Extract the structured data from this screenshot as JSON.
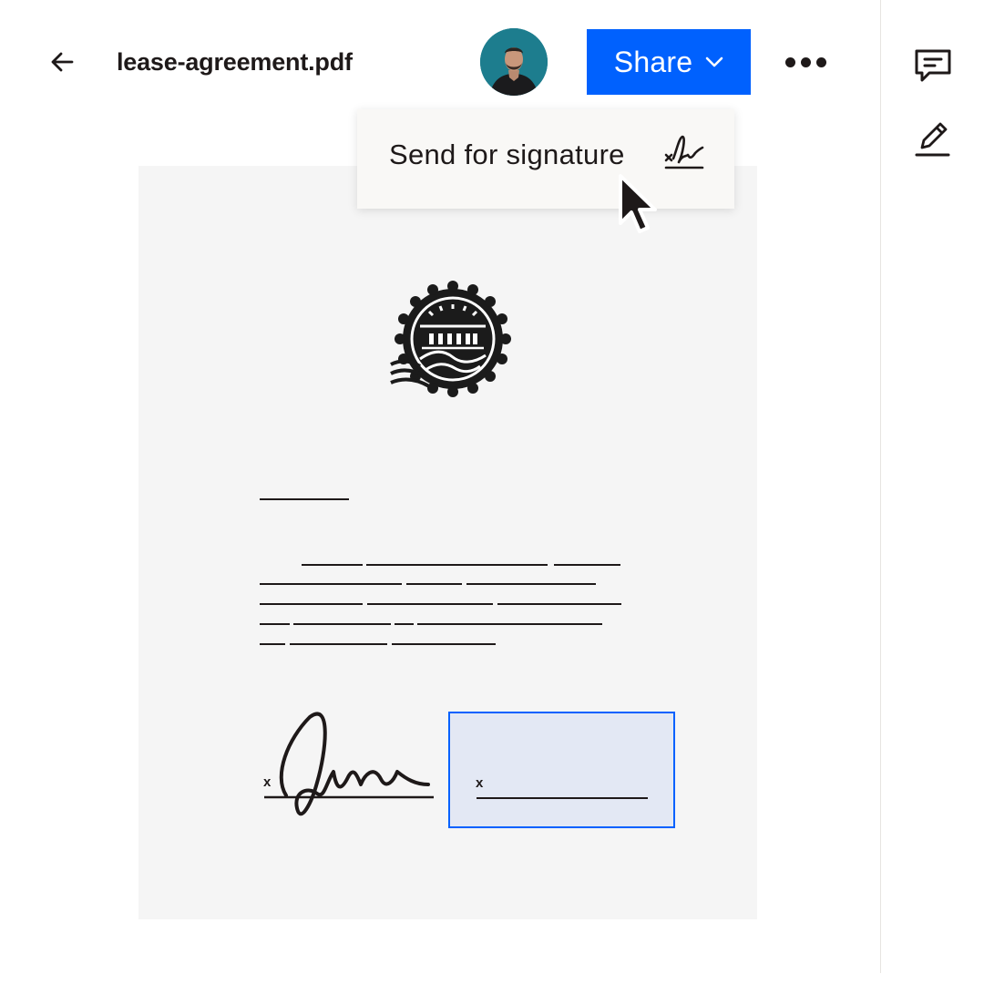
{
  "header": {
    "file_title": "lease-agreement.pdf",
    "share_label": "Share"
  },
  "share_menu": {
    "items": [
      {
        "label": "Send for signature",
        "icon": "signature-icon"
      }
    ]
  },
  "document": {
    "signature_marks": [
      "x",
      "x"
    ]
  },
  "icons": {
    "back": "arrow-left-icon",
    "more": "ellipsis-icon",
    "comment": "comment-icon",
    "edit": "pencil-icon",
    "cursor": "mouse-pointer-icon"
  },
  "colors": {
    "accent": "#0061fe",
    "signature_box": "#e3e8f4",
    "page": "#f5f5f5",
    "menu": "#f9f8f6"
  }
}
